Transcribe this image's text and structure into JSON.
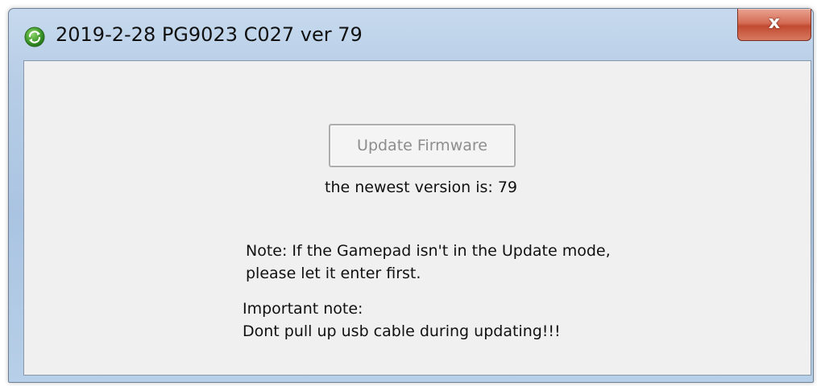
{
  "window": {
    "title": "2019-2-28 PG9023 C027 ver 79",
    "icon": "refresh-icon",
    "close_label": "x"
  },
  "main": {
    "update_button_label": "Update Firmware",
    "update_button_enabled": false,
    "version_text": "the newest version is: 79",
    "note_lines": [
      "Note: If the Gamepad isn't in the Update mode,",
      "please let it enter first."
    ],
    "important_lines": [
      "Important note:",
      "Dont pull up usb cable during updating!!!"
    ]
  },
  "colors": {
    "titlebar": "#b7cde6",
    "client_background": "#f0f0f0",
    "close_button": "#c24a31",
    "icon_green": "#3f9a2c",
    "disabled_text": "#8d8d8d"
  }
}
